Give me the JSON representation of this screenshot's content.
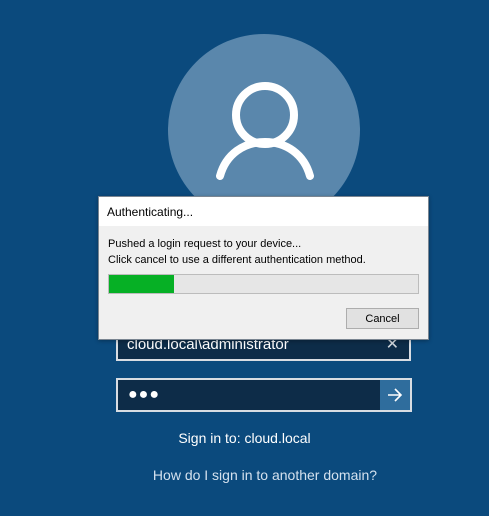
{
  "login": {
    "username": "cloud.local\\administrator",
    "password_masked": "●●●",
    "sign_in_to": "Sign in to: cloud.local",
    "other_domain_link": "How do I sign in to another domain?"
  },
  "dialog": {
    "title": "Authenticating...",
    "message_line1": "Pushed a login request to your device...",
    "message_line2": "Click cancel to use a different authentication method.",
    "progress_fraction": 0.21,
    "cancel_label": "Cancel"
  },
  "icons": {
    "avatar": "user-icon",
    "clear": "close-icon",
    "submit": "arrow-right-icon"
  },
  "colors": {
    "background": "#0b4a7d",
    "avatar_circle": "#5a87ac",
    "progress_fill": "#06b025",
    "submit_button": "#2f6d9d"
  }
}
